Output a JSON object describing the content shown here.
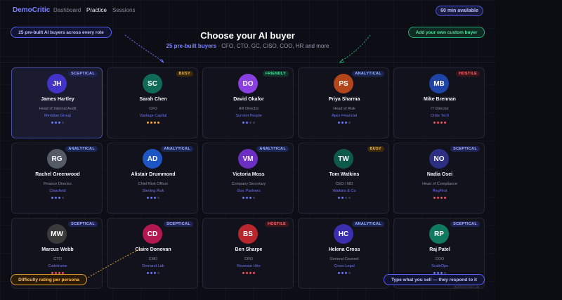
{
  "nav": {
    "brand": "DemoCritic",
    "links": [
      "Dashboard",
      "Practice",
      "Sessions"
    ],
    "time_pill": "60 min available"
  },
  "header": {
    "title": "Choose your AI buyer",
    "subtitle_highlight": "25 pre-built buyers",
    "subtitle_rest": " · CFO, CTO, GC, CISO, COO, HR and more"
  },
  "callouts": {
    "top_left": "25 pre-built AI buyers across every role",
    "top_right": "Add your own custom buyer",
    "bottom_left": "Difficulty rating per persona",
    "bottom_right": "Type what you sell — they respond to it"
  },
  "watermark": "democritic.ai",
  "colors": {
    "accent": "#7c83ff",
    "difficulty_dot_blue": "#6d74f5",
    "difficulty_dot_orange": "#f5a430",
    "difficulty_dot_red": "#f0505a"
  },
  "personas": [
    {
      "initials": "JH",
      "name": "James Hartley",
      "role": "Head of Internal Audit",
      "company": "Meridian Group",
      "badge": "SCEPTICAL",
      "difficulty": 3,
      "avatar_color": "#4334c9"
    },
    {
      "initials": "SC",
      "name": "Sarah Chen",
      "role": "CFO",
      "company": "Vantage Capital",
      "badge": "BUSY",
      "difficulty": 4,
      "avatar_color": "#0f6b57"
    },
    {
      "initials": "DO",
      "name": "David Okafor",
      "role": "HR Director",
      "company": "Summit People",
      "badge": "FRIENDLY",
      "difficulty": 2,
      "avatar_color": "#8a3fe0"
    },
    {
      "initials": "PS",
      "name": "Priya Sharma",
      "role": "Head of Risk",
      "company": "Apex Financial",
      "badge": "ANALYTICAL",
      "difficulty": 3,
      "avatar_color": "#b3451a"
    },
    {
      "initials": "MB",
      "name": "Mike Brennan",
      "role": "IT Director",
      "company": "Orbis Tech",
      "badge": "HOSTILE",
      "difficulty": 4,
      "avatar_color": "#1e44a8"
    },
    {
      "initials": "RG",
      "name": "Rachel Greenwood",
      "role": "Finance Director",
      "company": "Clearfield",
      "badge": "ANALYTICAL",
      "difficulty": 3,
      "avatar_color": "#545a66"
    },
    {
      "initials": "AD",
      "name": "Alistair Drummond",
      "role": "Chief Risk Officer",
      "company": "Sterling Risk",
      "badge": "ANALYTICAL",
      "difficulty": 3,
      "avatar_color": "#1d55c4"
    },
    {
      "initials": "VM",
      "name": "Victoria Moss",
      "role": "Company Secretary",
      "company": "Gov. Partners",
      "badge": "ANALYTICAL",
      "difficulty": 3,
      "avatar_color": "#6b2fc2"
    },
    {
      "initials": "TW",
      "name": "Tom Watkins",
      "role": "CEO / MD",
      "company": "Watkins & Co",
      "badge": "BUSY",
      "difficulty": 2,
      "avatar_color": "#0e5a4a"
    },
    {
      "initials": "NO",
      "name": "Nadia Osei",
      "role": "Head of Compliance",
      "company": "RegFirst",
      "badge": "SCEPTICAL",
      "difficulty": 4,
      "avatar_color": "#2c2f82"
    },
    {
      "initials": "MW",
      "name": "Marcus Webb",
      "role": "CTO",
      "company": "Codeframe",
      "badge": "SCEPTICAL",
      "difficulty": 4,
      "avatar_color": "#3a3a3a"
    },
    {
      "initials": "CD",
      "name": "Claire Donovan",
      "role": "CMO",
      "company": "Demand Lab",
      "badge": "SCEPTICAL",
      "difficulty": 3,
      "avatar_color": "#b3184e"
    },
    {
      "initials": "BS",
      "name": "Ben Sharpe",
      "role": "CRO",
      "company": "Revenue Hire",
      "badge": "HOSTILE",
      "difficulty": 4,
      "avatar_color": "#b8272b"
    },
    {
      "initials": "HC",
      "name": "Helena Cross",
      "role": "General Counsel",
      "company": "Cross Legal",
      "badge": "ANALYTICAL",
      "difficulty": 3,
      "avatar_color": "#3b2fb0"
    },
    {
      "initials": "RP",
      "name": "Raj Patel",
      "role": "COO",
      "company": "ScaleOps",
      "badge": "SCEPTICAL",
      "difficulty": 3,
      "avatar_color": "#0f7a5f"
    }
  ]
}
